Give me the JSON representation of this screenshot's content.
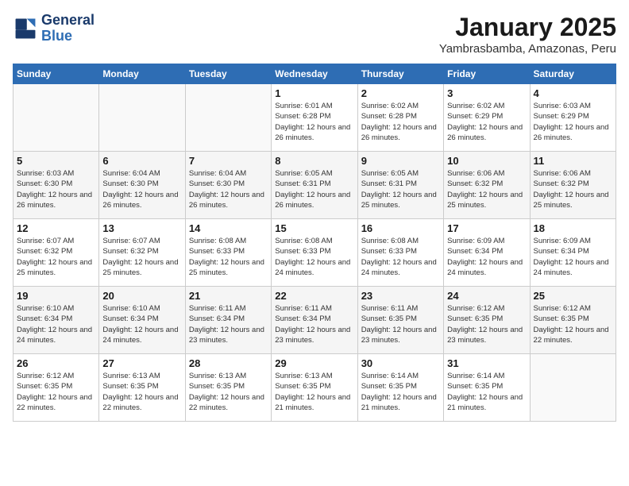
{
  "header": {
    "logo_line1": "General",
    "logo_line2": "Blue",
    "month": "January 2025",
    "location": "Yambrasbamba, Amazonas, Peru"
  },
  "days_of_week": [
    "Sunday",
    "Monday",
    "Tuesday",
    "Wednesday",
    "Thursday",
    "Friday",
    "Saturday"
  ],
  "weeks": [
    [
      {
        "day": "",
        "info": ""
      },
      {
        "day": "",
        "info": ""
      },
      {
        "day": "",
        "info": ""
      },
      {
        "day": "1",
        "info": "Sunrise: 6:01 AM\nSunset: 6:28 PM\nDaylight: 12 hours\nand 26 minutes."
      },
      {
        "day": "2",
        "info": "Sunrise: 6:02 AM\nSunset: 6:28 PM\nDaylight: 12 hours\nand 26 minutes."
      },
      {
        "day": "3",
        "info": "Sunrise: 6:02 AM\nSunset: 6:29 PM\nDaylight: 12 hours\nand 26 minutes."
      },
      {
        "day": "4",
        "info": "Sunrise: 6:03 AM\nSunset: 6:29 PM\nDaylight: 12 hours\nand 26 minutes."
      }
    ],
    [
      {
        "day": "5",
        "info": "Sunrise: 6:03 AM\nSunset: 6:30 PM\nDaylight: 12 hours\nand 26 minutes."
      },
      {
        "day": "6",
        "info": "Sunrise: 6:04 AM\nSunset: 6:30 PM\nDaylight: 12 hours\nand 26 minutes."
      },
      {
        "day": "7",
        "info": "Sunrise: 6:04 AM\nSunset: 6:30 PM\nDaylight: 12 hours\nand 26 minutes."
      },
      {
        "day": "8",
        "info": "Sunrise: 6:05 AM\nSunset: 6:31 PM\nDaylight: 12 hours\nand 26 minutes."
      },
      {
        "day": "9",
        "info": "Sunrise: 6:05 AM\nSunset: 6:31 PM\nDaylight: 12 hours\nand 25 minutes."
      },
      {
        "day": "10",
        "info": "Sunrise: 6:06 AM\nSunset: 6:32 PM\nDaylight: 12 hours\nand 25 minutes."
      },
      {
        "day": "11",
        "info": "Sunrise: 6:06 AM\nSunset: 6:32 PM\nDaylight: 12 hours\nand 25 minutes."
      }
    ],
    [
      {
        "day": "12",
        "info": "Sunrise: 6:07 AM\nSunset: 6:32 PM\nDaylight: 12 hours\nand 25 minutes."
      },
      {
        "day": "13",
        "info": "Sunrise: 6:07 AM\nSunset: 6:32 PM\nDaylight: 12 hours\nand 25 minutes."
      },
      {
        "day": "14",
        "info": "Sunrise: 6:08 AM\nSunset: 6:33 PM\nDaylight: 12 hours\nand 25 minutes."
      },
      {
        "day": "15",
        "info": "Sunrise: 6:08 AM\nSunset: 6:33 PM\nDaylight: 12 hours\nand 24 minutes."
      },
      {
        "day": "16",
        "info": "Sunrise: 6:08 AM\nSunset: 6:33 PM\nDaylight: 12 hours\nand 24 minutes."
      },
      {
        "day": "17",
        "info": "Sunrise: 6:09 AM\nSunset: 6:34 PM\nDaylight: 12 hours\nand 24 minutes."
      },
      {
        "day": "18",
        "info": "Sunrise: 6:09 AM\nSunset: 6:34 PM\nDaylight: 12 hours\nand 24 minutes."
      }
    ],
    [
      {
        "day": "19",
        "info": "Sunrise: 6:10 AM\nSunset: 6:34 PM\nDaylight: 12 hours\nand 24 minutes."
      },
      {
        "day": "20",
        "info": "Sunrise: 6:10 AM\nSunset: 6:34 PM\nDaylight: 12 hours\nand 24 minutes."
      },
      {
        "day": "21",
        "info": "Sunrise: 6:11 AM\nSunset: 6:34 PM\nDaylight: 12 hours\nand 23 minutes."
      },
      {
        "day": "22",
        "info": "Sunrise: 6:11 AM\nSunset: 6:34 PM\nDaylight: 12 hours\nand 23 minutes."
      },
      {
        "day": "23",
        "info": "Sunrise: 6:11 AM\nSunset: 6:35 PM\nDaylight: 12 hours\nand 23 minutes."
      },
      {
        "day": "24",
        "info": "Sunrise: 6:12 AM\nSunset: 6:35 PM\nDaylight: 12 hours\nand 23 minutes."
      },
      {
        "day": "25",
        "info": "Sunrise: 6:12 AM\nSunset: 6:35 PM\nDaylight: 12 hours\nand 22 minutes."
      }
    ],
    [
      {
        "day": "26",
        "info": "Sunrise: 6:12 AM\nSunset: 6:35 PM\nDaylight: 12 hours\nand 22 minutes."
      },
      {
        "day": "27",
        "info": "Sunrise: 6:13 AM\nSunset: 6:35 PM\nDaylight: 12 hours\nand 22 minutes."
      },
      {
        "day": "28",
        "info": "Sunrise: 6:13 AM\nSunset: 6:35 PM\nDaylight: 12 hours\nand 22 minutes."
      },
      {
        "day": "29",
        "info": "Sunrise: 6:13 AM\nSunset: 6:35 PM\nDaylight: 12 hours\nand 21 minutes."
      },
      {
        "day": "30",
        "info": "Sunrise: 6:14 AM\nSunset: 6:35 PM\nDaylight: 12 hours\nand 21 minutes."
      },
      {
        "day": "31",
        "info": "Sunrise: 6:14 AM\nSunset: 6:35 PM\nDaylight: 12 hours\nand 21 minutes."
      },
      {
        "day": "",
        "info": ""
      }
    ]
  ]
}
